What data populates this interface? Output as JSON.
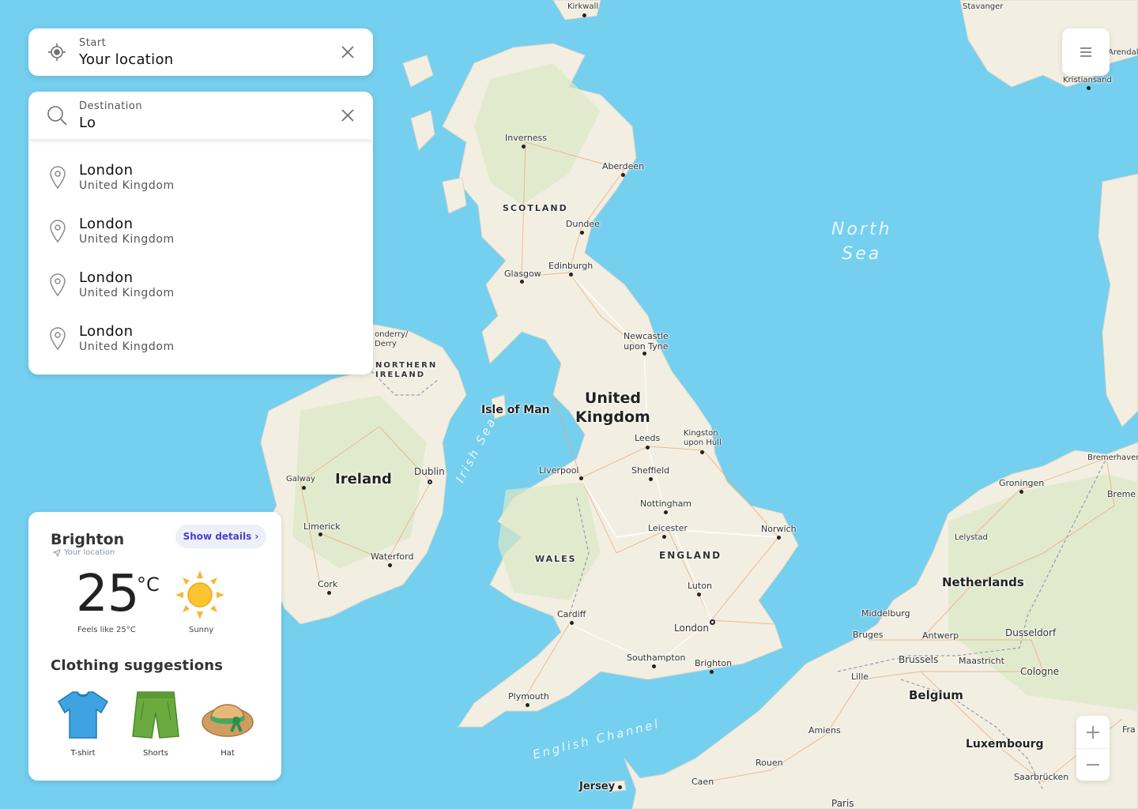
{
  "search": {
    "start": {
      "label": "Start",
      "value": "Your location"
    },
    "destination": {
      "label": "Destination",
      "value": "Lo"
    },
    "suggestions": [
      {
        "name": "London",
        "country": "United Kingdom"
      },
      {
        "name": "London",
        "country": "United Kingdom"
      },
      {
        "name": "London",
        "country": "United Kingdom"
      },
      {
        "name": "London",
        "country": "United Kingdom"
      }
    ]
  },
  "weather": {
    "city": "Brighton",
    "location_note": "Your location",
    "show_details": "Show details ›",
    "temperature": "25",
    "unit": "°C",
    "feels_like": "Feels like 25°C",
    "condition": "Sunny",
    "clothing_title": "Clothing suggestions",
    "clothing": [
      "T-shirt",
      "Shorts",
      "Hat"
    ]
  },
  "map": {
    "cities": [
      "Kirkwall",
      "Stavanger",
      "Arendal",
      "Kristiansand",
      "Inverness",
      "Aberdeen",
      "Dundee",
      "Edinburgh",
      "Glasgow",
      "Londonderry/ Derry",
      "Newcastle upon Tyne",
      "Leeds",
      "Kingston upon Hull",
      "Liverpool",
      "Sheffield",
      "Nottingham",
      "Leicester",
      "Norwich",
      "Luton",
      "London",
      "Cardiff",
      "Southampton",
      "Brighton",
      "Plymouth",
      "Dublin",
      "Galway",
      "Limerick",
      "Waterford",
      "Cork",
      "Bremerhaven",
      "Groningen",
      "Bremen",
      "Lelystad",
      "Middelburg",
      "Bruges",
      "Antwerp",
      "Dusseldorf",
      "Brussels",
      "Maastricht",
      "Cologne",
      "Lille",
      "Amiens",
      "Rouen",
      "Caen",
      "Paris",
      "Saarbrücken",
      "Jersey",
      "Fra"
    ],
    "regions": [
      "SCOTLAND",
      "NORTHERN IRELAND",
      "WALES",
      "ENGLAND"
    ],
    "countries": [
      "United Kingdom",
      "Ireland",
      "Netherlands",
      "Belgium",
      "Luxembourg",
      "Isle of Man"
    ],
    "seas": [
      "North Sea",
      "Irish Sea",
      "English Channel"
    ]
  },
  "colors": {
    "water": "#75cfef",
    "land": "#f2efe2",
    "accent": "#4a3fd1"
  },
  "icons": [
    "locate-icon",
    "search-icon",
    "close-icon",
    "pin-icon",
    "menu-icon",
    "plus-icon",
    "minus-icon",
    "sun-icon",
    "navigation-arrow-icon",
    "tshirt-icon",
    "shorts-icon",
    "hat-icon"
  ]
}
